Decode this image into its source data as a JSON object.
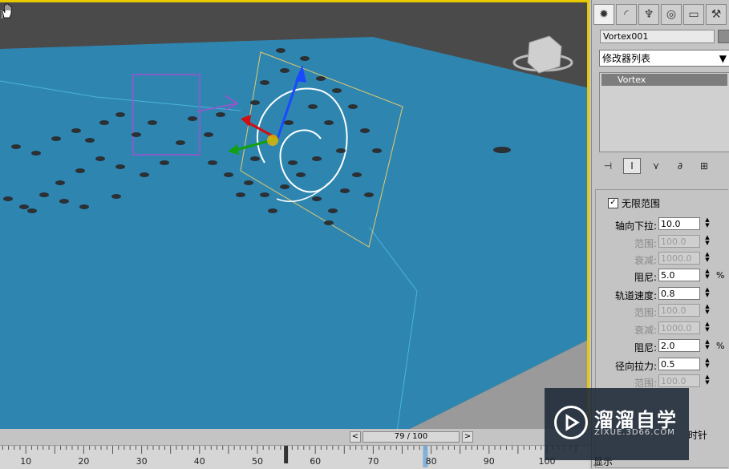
{
  "viewport": {
    "corner_label": "]"
  },
  "panel": {
    "tabs": [
      {
        "name": "create-tab",
        "glyph": "✹"
      },
      {
        "name": "modify-tab",
        "glyph": "◜"
      },
      {
        "name": "hierarchy-tab",
        "glyph": "♆"
      },
      {
        "name": "motion-tab",
        "glyph": "◎"
      },
      {
        "name": "display-tab",
        "glyph": "▭"
      },
      {
        "name": "utilities-tab",
        "glyph": "⚒"
      }
    ],
    "object_name": "Vortex001",
    "modifier_list": "修改器列表",
    "stack_items": [
      "Vortex"
    ],
    "stack_tools": [
      "⊣",
      "Ι",
      "⋎",
      "∂",
      "⊞"
    ],
    "unlimited_range_label": "无限范围",
    "unlimited_range_checked": "✓",
    "params": [
      {
        "label": "轴向下拉:",
        "value": "10.0",
        "disabled": false,
        "pct": ""
      },
      {
        "label": "范围:",
        "value": "100.0",
        "disabled": true,
        "pct": ""
      },
      {
        "label": "衰减:",
        "value": "1000.0",
        "disabled": true,
        "pct": ""
      },
      {
        "label": "阻尼:",
        "value": "5.0",
        "disabled": false,
        "pct": "%"
      },
      {
        "label": "轨道速度:",
        "value": "0.8",
        "disabled": false,
        "pct": ""
      },
      {
        "label": "范围:",
        "value": "100.0",
        "disabled": true,
        "pct": ""
      },
      {
        "label": "衰减:",
        "value": "1000.0",
        "disabled": true,
        "pct": ""
      },
      {
        "label": "阻尼:",
        "value": "2.0",
        "disabled": false,
        "pct": "%"
      },
      {
        "label": "径向拉力:",
        "value": "0.5",
        "disabled": false,
        "pct": ""
      },
      {
        "label": "范围:",
        "value": "100.0",
        "disabled": true,
        "pct": ""
      }
    ],
    "partial_clockwise": "时针",
    "partial_bottom": "显示"
  },
  "timeline": {
    "frame_display": "79 / 100",
    "prev": "<",
    "next": ">",
    "current_frame": 79,
    "total_frames": 100,
    "tick_labels": [
      "10",
      "20",
      "30",
      "40",
      "50",
      "60",
      "70",
      "80",
      "90",
      "100"
    ]
  },
  "watermark": {
    "title": "溜溜自学",
    "subtitle": "ZIXUE.3D66.COM"
  },
  "colors": {
    "water": "#2e86b0",
    "viewport_bg": "#4a4a4a",
    "active_border": "#e8c800",
    "gizmo_outline": "#e8c86a",
    "selection_box": "#a050d0"
  }
}
